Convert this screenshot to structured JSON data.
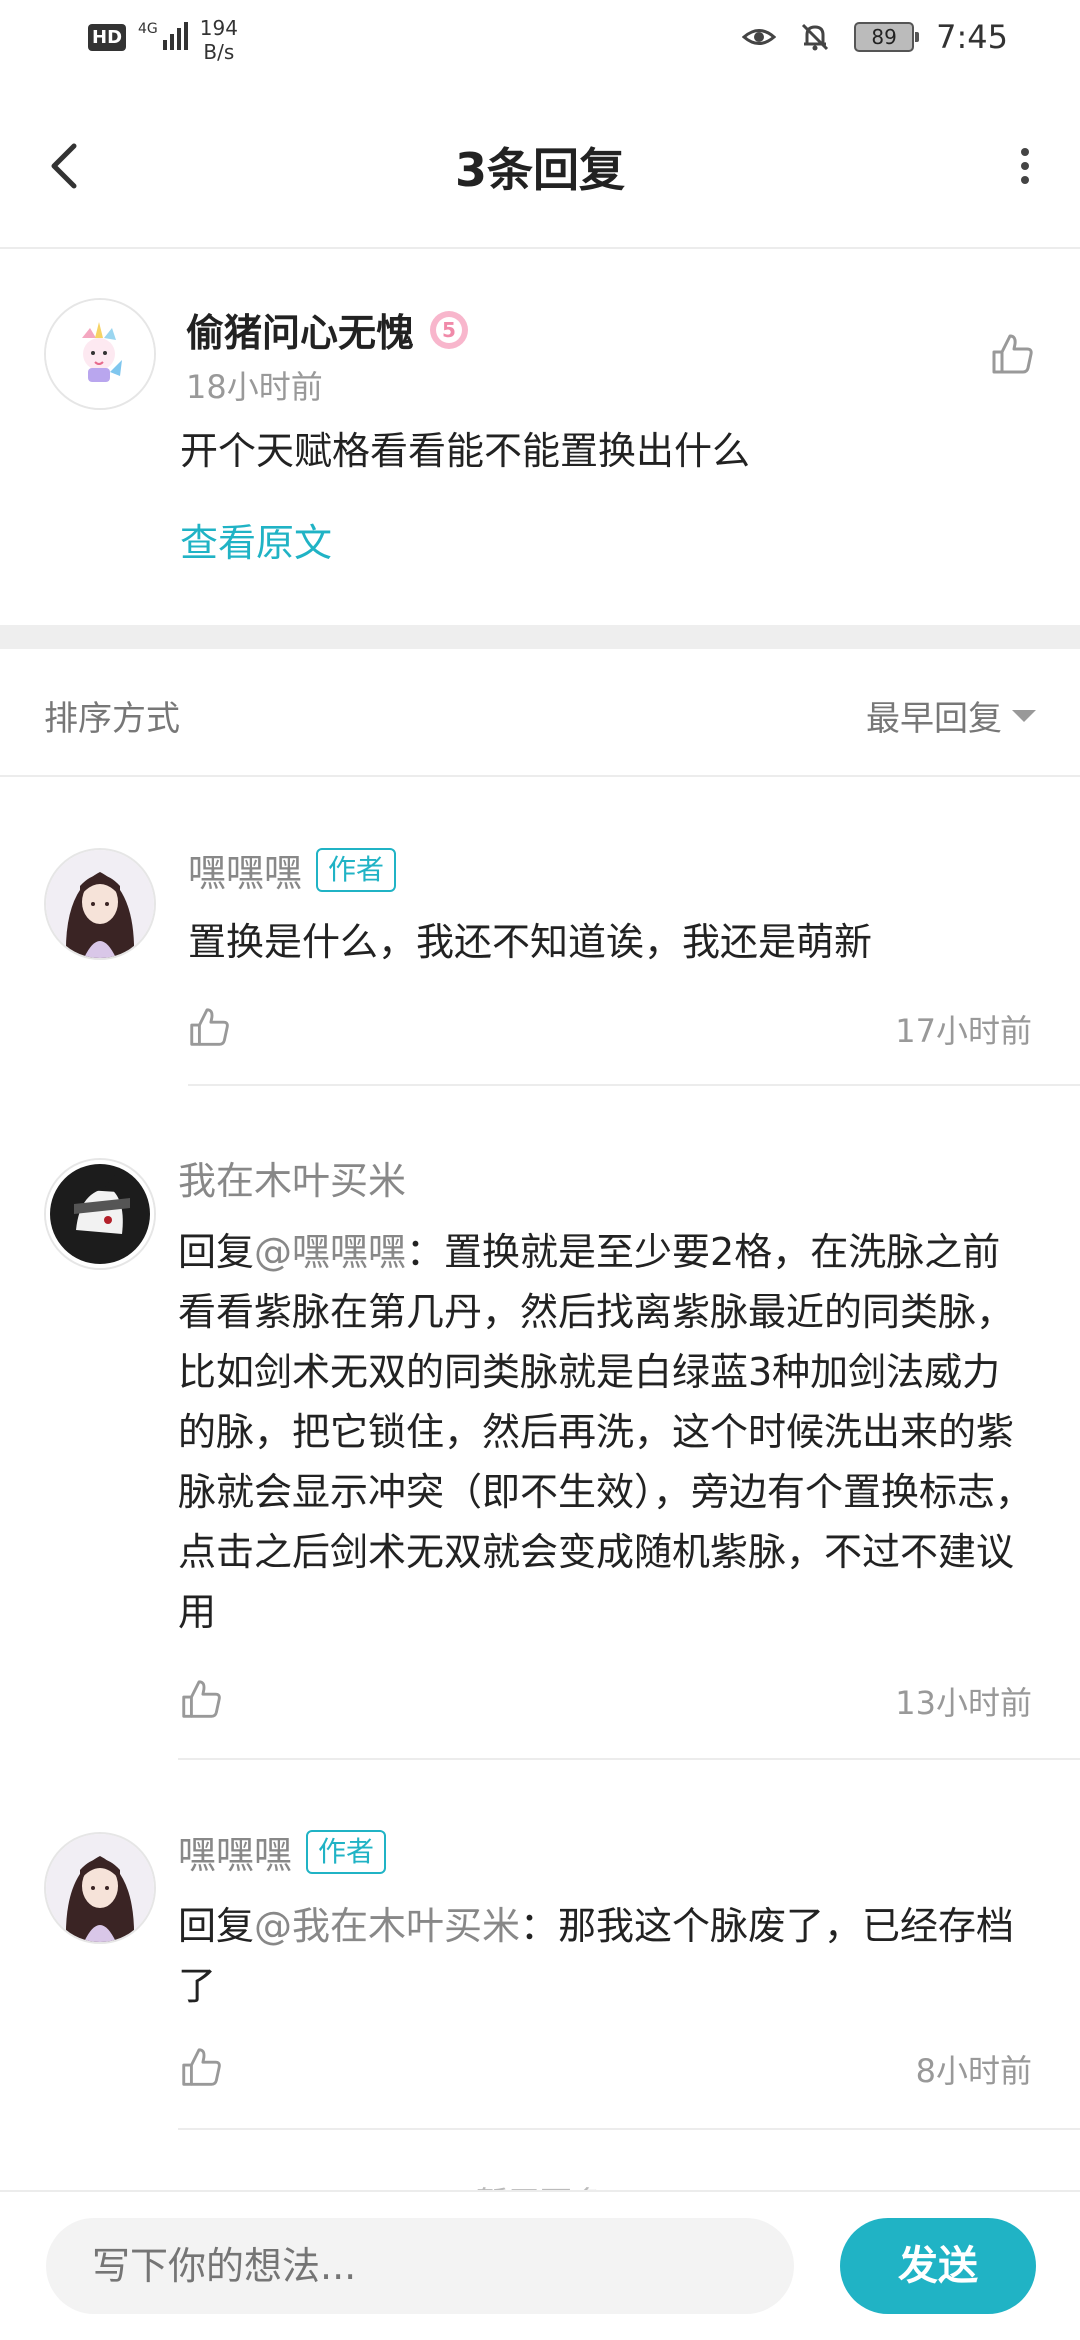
{
  "status_bar": {
    "hd": "HD",
    "network": "4G",
    "speed_value": "194",
    "speed_unit": "B/s",
    "battery": "89",
    "time": "7:45"
  },
  "header": {
    "title": "3条回复"
  },
  "post": {
    "author": "偷猪问心无愧",
    "time": "18小时前",
    "content": "开个天赋格看看能不能置换出什么",
    "view_original": "查看原文"
  },
  "sort": {
    "label": "排序方式",
    "value": "最早回复"
  },
  "replies": [
    {
      "author": "嘿嘿嘿",
      "tag": "作者",
      "prefix": "",
      "mention": "",
      "text": "置换是什么，我还不知道诶，我还是萌新",
      "time": "17小时前"
    },
    {
      "author": "我在木叶买米",
      "tag": "",
      "prefix": "回复",
      "mention": "@嘿嘿嘿",
      "text": "：置换就是至少要2格，在洗脉之前看看紫脉在第几丹，然后找离紫脉最近的同类脉，比如剑术无双的同类脉就是白绿蓝3种加剑法威力的脉，把它锁住，然后再洗，这个时候洗出来的紫脉就会显示冲突（即不生效），旁边有个置换标志，点击之后剑术无双就会变成随机紫脉，不过不建议用",
      "time": "13小时前"
    },
    {
      "author": "嘿嘿嘿",
      "tag": "作者",
      "prefix": "回复",
      "mention": "@我在木叶买米",
      "text": "：那我这个脉废了，已经存档了",
      "time": "8小时前"
    }
  ],
  "footer_hint": "暂无更多",
  "bottom": {
    "placeholder": "写下你的想法...",
    "send": "发送"
  },
  "colors": {
    "accent": "#20b3c5"
  }
}
